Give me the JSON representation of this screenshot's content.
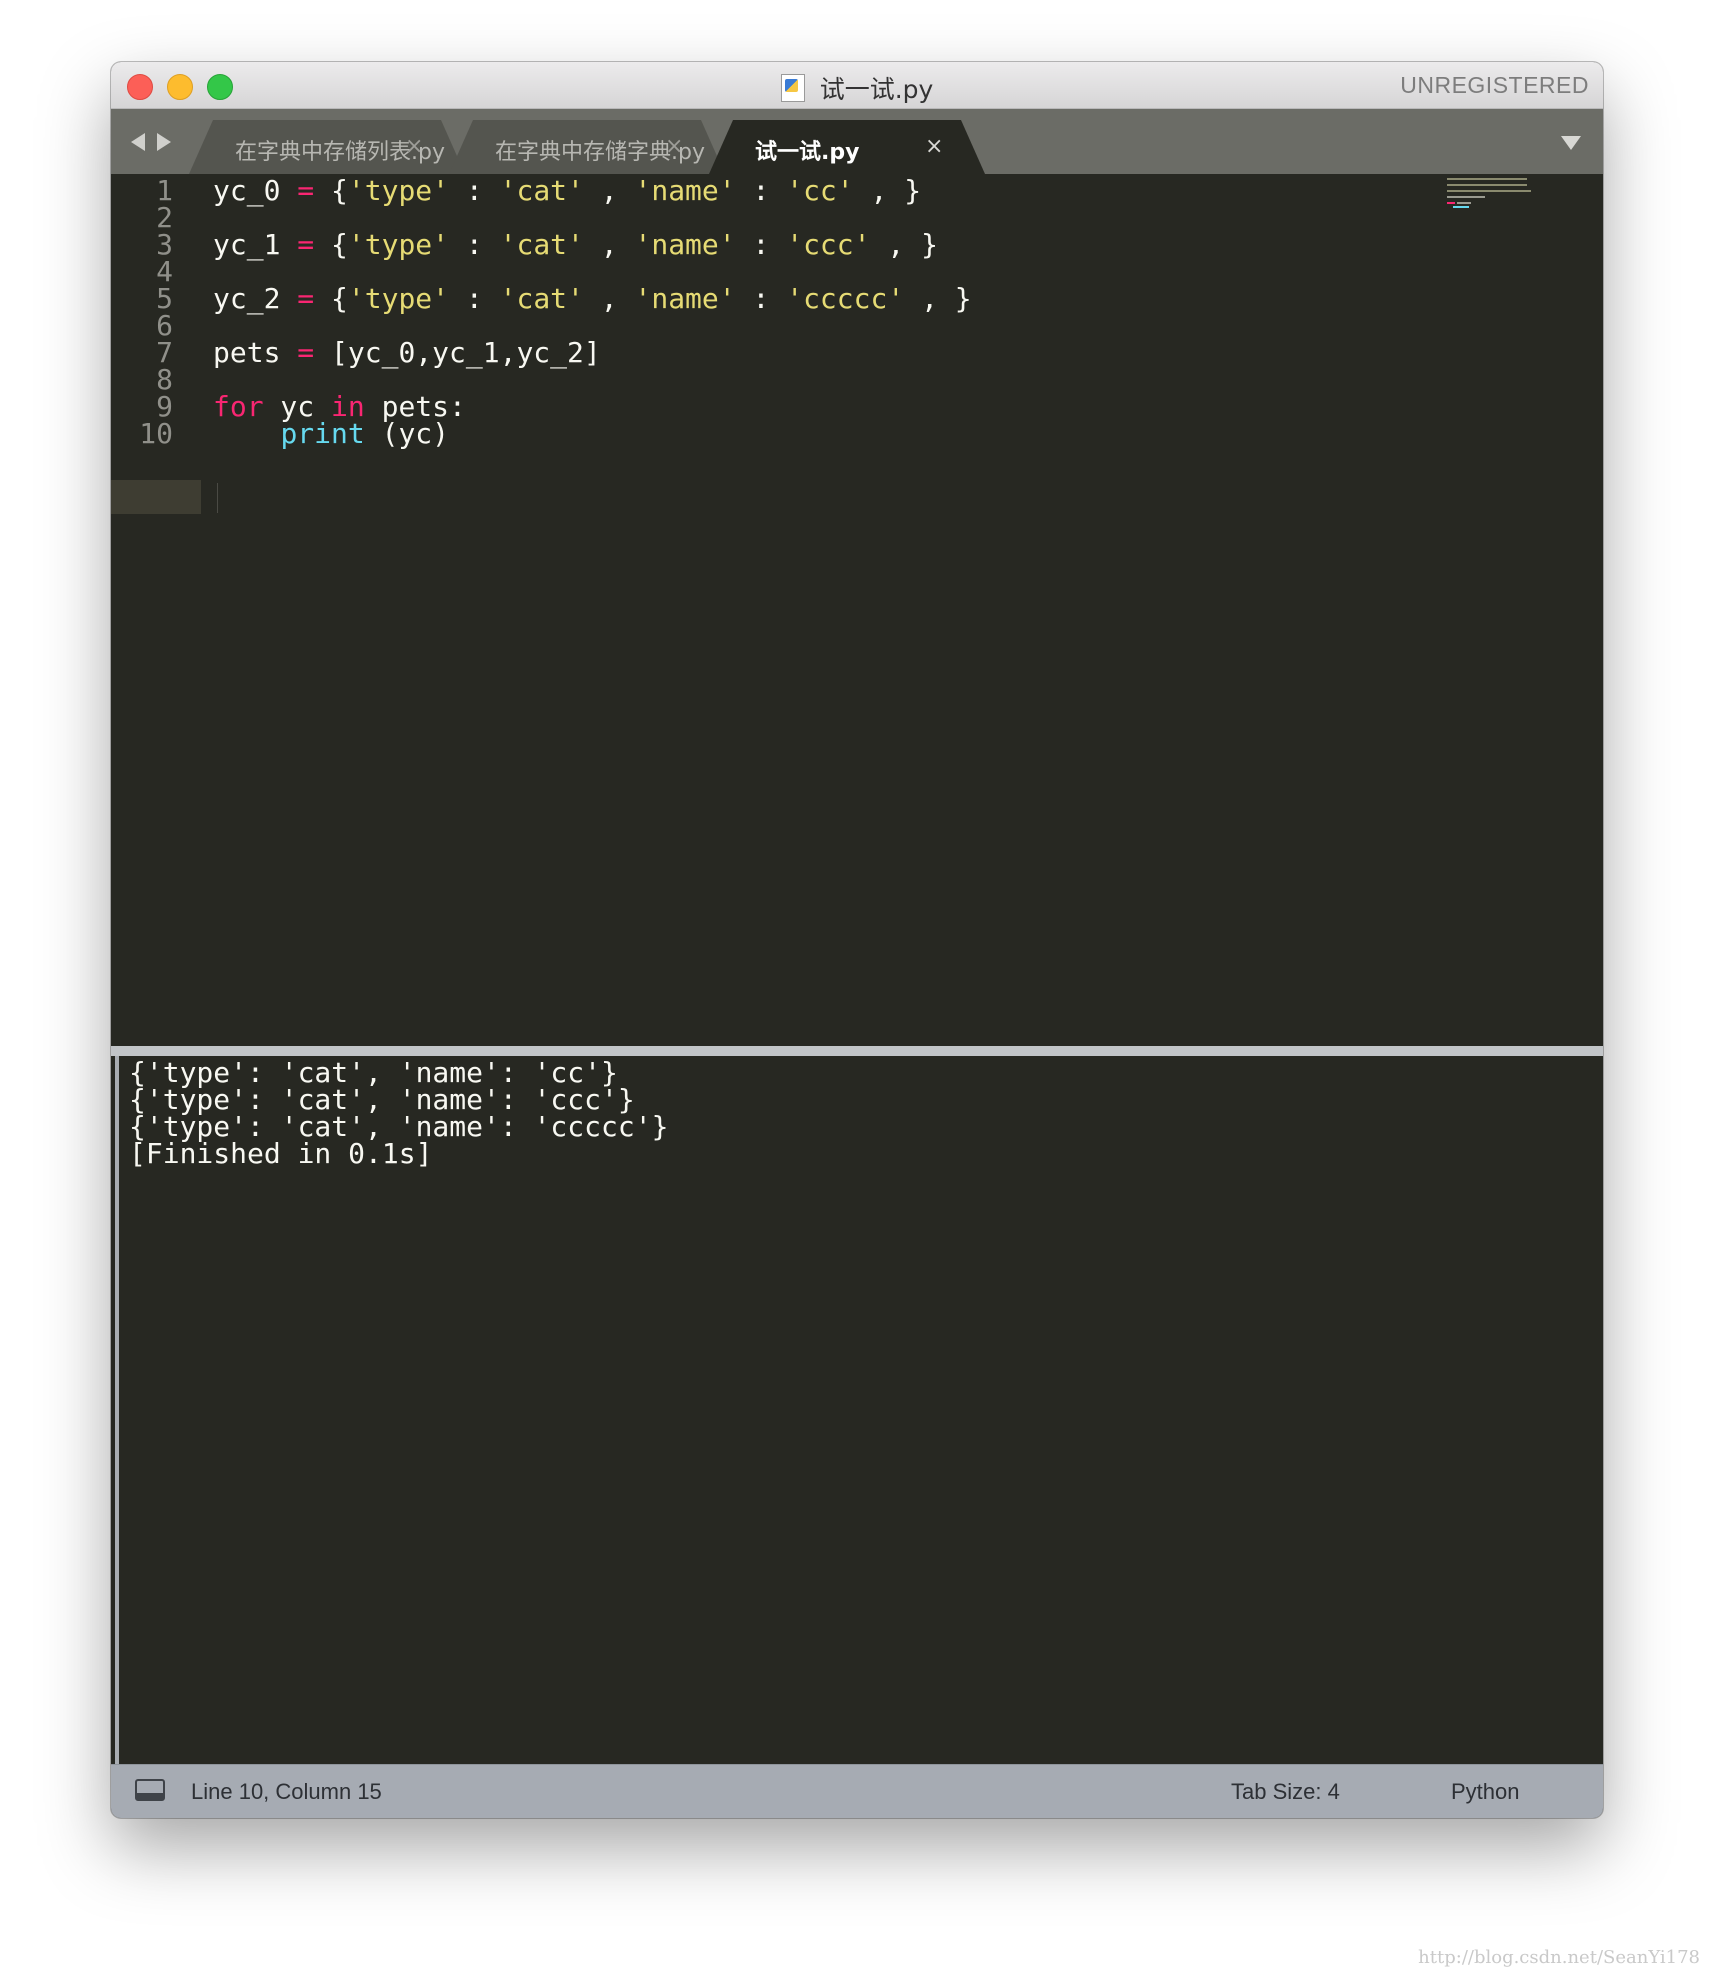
{
  "window": {
    "title": "试一试.py",
    "registration": "UNREGISTERED"
  },
  "tabs": [
    {
      "label": "在字典中存储列表.py",
      "close": "×",
      "active": false
    },
    {
      "label": "在字典中存储字典.py",
      "close": "×",
      "active": false
    },
    {
      "label": "试一试.py",
      "close": "×",
      "active": true
    }
  ],
  "editor": {
    "language": "Python",
    "current_line": 10,
    "lines": [
      {
        "num": "1",
        "tokens": [
          [
            "p",
            "yc_0 "
          ],
          [
            "kw",
            "="
          ],
          [
            "p",
            " {"
          ],
          [
            "str",
            "'type'"
          ],
          [
            "p",
            " : "
          ],
          [
            "str",
            "'cat'"
          ],
          [
            "p",
            " , "
          ],
          [
            "str",
            "'name'"
          ],
          [
            "p",
            " : "
          ],
          [
            "str",
            "'cc'"
          ],
          [
            "p",
            " , }"
          ]
        ]
      },
      {
        "num": "2",
        "tokens": []
      },
      {
        "num": "3",
        "tokens": [
          [
            "p",
            "yc_1 "
          ],
          [
            "kw",
            "="
          ],
          [
            "p",
            " {"
          ],
          [
            "str",
            "'type'"
          ],
          [
            "p",
            " : "
          ],
          [
            "str",
            "'cat'"
          ],
          [
            "p",
            " , "
          ],
          [
            "str",
            "'name'"
          ],
          [
            "p",
            " : "
          ],
          [
            "str",
            "'ccc'"
          ],
          [
            "p",
            " , }"
          ]
        ]
      },
      {
        "num": "4",
        "tokens": []
      },
      {
        "num": "5",
        "tokens": [
          [
            "p",
            "yc_2 "
          ],
          [
            "kw",
            "="
          ],
          [
            "p",
            " {"
          ],
          [
            "str",
            "'type'"
          ],
          [
            "p",
            " : "
          ],
          [
            "str",
            "'cat'"
          ],
          [
            "p",
            " , "
          ],
          [
            "str",
            "'name'"
          ],
          [
            "p",
            " : "
          ],
          [
            "str",
            "'ccccc'"
          ],
          [
            "p",
            " , }"
          ]
        ]
      },
      {
        "num": "6",
        "tokens": []
      },
      {
        "num": "7",
        "tokens": [
          [
            "p",
            "pets "
          ],
          [
            "kw",
            "="
          ],
          [
            "p",
            " [yc_0,yc_1,yc_2]"
          ]
        ]
      },
      {
        "num": "8",
        "tokens": []
      },
      {
        "num": "9",
        "tokens": [
          [
            "kw",
            "for"
          ],
          [
            "p",
            " yc "
          ],
          [
            "kw",
            "in"
          ],
          [
            "p",
            " pets:"
          ]
        ]
      },
      {
        "num": "10",
        "tokens": [
          [
            "p",
            "    "
          ],
          [
            "fn",
            "print"
          ],
          [
            "p",
            " (yc)"
          ]
        ]
      }
    ]
  },
  "output": {
    "lines": [
      "{'type': 'cat', 'name': 'cc'}",
      "{'type': 'cat', 'name': 'ccc'}",
      "{'type': 'cat', 'name': 'ccccc'}",
      "[Finished in 0.1s]"
    ]
  },
  "status": {
    "position": "Line 10, Column 15",
    "tab_size": "Tab Size: 4",
    "syntax": "Python"
  },
  "watermark": "http://blog.csdn.net/SeanYi178",
  "colors": {
    "background": "#272822",
    "keyword": "#f92672",
    "string": "#e6db74",
    "function": "#66d9ef",
    "text": "#f8f8f2"
  }
}
